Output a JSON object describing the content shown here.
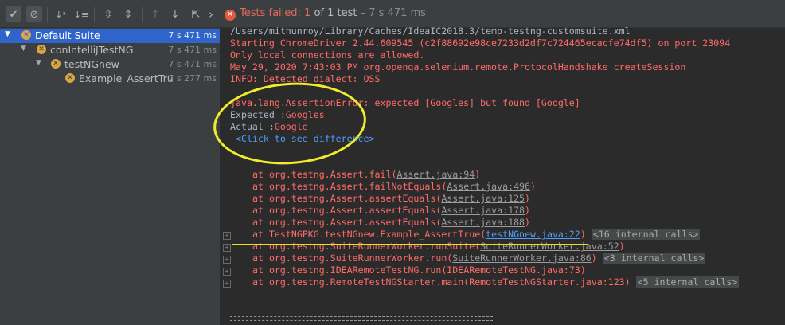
{
  "toolbar": {
    "buttons": [
      {
        "name": "show-passed-button",
        "icon": "checkmark-icon",
        "glyph": "✔"
      },
      {
        "name": "show-ignored-button",
        "icon": "ignored-icon",
        "glyph": "⊘"
      },
      {
        "name": "sort-alpha-button",
        "icon": "sort-alphabetically-icon",
        "glyph": "↓ᵃ"
      },
      {
        "name": "sort-duration-button",
        "icon": "sort-duration-icon",
        "glyph": "↓≡"
      },
      {
        "name": "expand-all-button",
        "icon": "expand-all-icon",
        "glyph": "⇳"
      },
      {
        "name": "collapse-all-button",
        "icon": "collapse-all-icon",
        "glyph": "⇕"
      },
      {
        "name": "previous-failed-button",
        "icon": "arrow-up-icon",
        "glyph": "↑"
      },
      {
        "name": "next-failed-button",
        "icon": "arrow-down-icon",
        "glyph": "↓"
      },
      {
        "name": "export-button",
        "icon": "export-icon",
        "glyph": "⇱"
      },
      {
        "name": "more-button",
        "icon": "chevron-right-icon",
        "glyph": "›"
      }
    ],
    "status": {
      "label": "Tests failed: ",
      "failed": "1",
      "of_total": " of 1 test",
      "time": " – 7 s 471 ms"
    }
  },
  "tree": [
    {
      "label": "Default Suite",
      "time": "7 s 471 ms",
      "selected": true
    },
    {
      "label": "conIntelliJTestNG",
      "time": "7 s 471 ms"
    },
    {
      "label": "testNGnew",
      "time": "7 s 471 ms"
    },
    {
      "label": "Example_AssertTru",
      "time": "7 s 277 ms"
    }
  ],
  "console": {
    "l1": "/Users/mithunroy/Library/Caches/IdeaIC2018.3/temp-testng-customsuite.xml",
    "l2": "Starting ChromeDriver 2.44.609545 (c2f88692e98ce7233d2df7c724465ecacfe74df5) on port 23094",
    "l3": "Only local connections are allowed.",
    "l4": "May 29, 2020 7:43:03 PM org.openqa.selenium.remote.ProtocolHandshake createSession",
    "l5": "INFO: Detected dialect: OSS",
    "error": "java.lang.AssertionError: expected [Googles] but found [Google]",
    "expected_label": "Expected :",
    "expected_value": "Googles",
    "actual_label": "Actual   :",
    "actual_value": "Google",
    "diff_link": "<Click to see difference>",
    "stack": [
      {
        "pre": "at org.testng.Assert.fail(",
        "link": "Assert.java:94",
        "post": ")"
      },
      {
        "pre": "at org.testng.Assert.failNotEquals(",
        "link": "Assert.java:496",
        "post": ")"
      },
      {
        "pre": "at org.testng.Assert.assertEquals(",
        "link": "Assert.java:125",
        "post": ")"
      },
      {
        "pre": "at org.testng.Assert.assertEquals(",
        "link": "Assert.java:178",
        "post": ")"
      },
      {
        "pre": "at org.testng.Assert.assertEquals(",
        "link": "Assert.java:188",
        "post": ")"
      },
      {
        "pre": "at TestNGPKG.testNGnew.Example_AssertTrue(",
        "link": "testNGnew.java:22",
        "post": ") ",
        "chip": "<16 internal calls>"
      },
      {
        "pre": "at org.testng.SuiteRunnerWorker.runSuite(",
        "link": "SuiteRunnerWorker.java:52",
        "post": ")"
      },
      {
        "pre": "at org.testng.SuiteRunnerWorker.run(",
        "link": "SuiteRunnerWorker.java:86",
        "post": ") ",
        "chip": "<3 internal calls>"
      },
      {
        "pre": "at org.testng.IDEARemoteTestNG.run(IDEARemoteTestNG.java:73)",
        "link": "",
        "post": ""
      },
      {
        "pre": "at org.testng.RemoteTestNGStarter.main(RemoteTestNGStarter.java:123)",
        "link": "",
        "post": " ",
        "chip": "<5 internal calls>"
      }
    ]
  }
}
